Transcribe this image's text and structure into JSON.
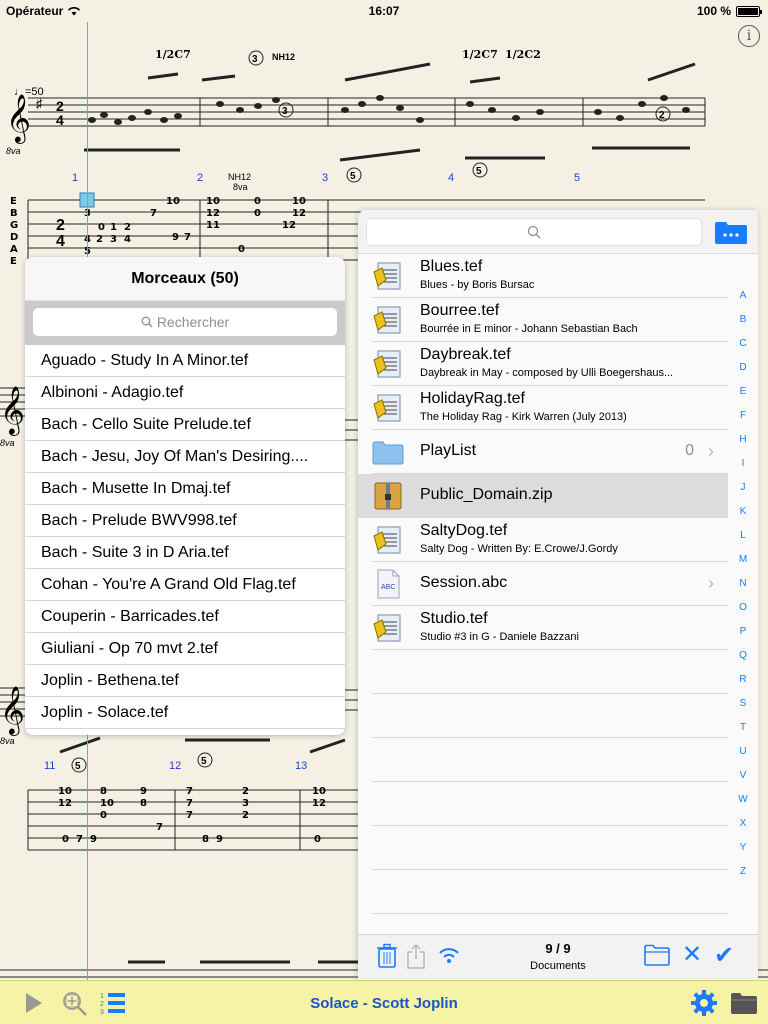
{
  "status": {
    "carrier": "Opérateur",
    "time": "16:07",
    "battery": "100 %"
  },
  "score": {
    "tempo": "♩=50",
    "measure_numbers": [
      "1",
      "2",
      "3",
      "4",
      "5",
      "11",
      "12",
      "13"
    ]
  },
  "library": {
    "title": "Morceaux (50)",
    "search_placeholder": "Rechercher",
    "items": [
      "Aguado - Study In A Minor.tef",
      "Albinoni - Adagio.tef",
      "Bach - Cello Suite Prelude.tef",
      "Bach - Jesu, Joy Of Man's Desiring....",
      "Bach - Musette In Dmaj.tef",
      "Bach - Prelude BWV998.tef",
      "Bach - Suite 3 in D Aria.tef",
      "Cohan - You're A Grand Old Flag.tef",
      "Couperin - Barricades.tef",
      "Giuliani - Op 70 mvt 2.tef",
      "Joplin - Bethena.tef",
      "Joplin - Solace.tef"
    ]
  },
  "files": {
    "rows": [
      {
        "icon": "tef-file-icon",
        "title": "Blues.tef",
        "subtitle": "Blues - by Boris Bursac"
      },
      {
        "icon": "tef-file-icon",
        "title": "Bourree.tef",
        "subtitle": "Bourrée in E minor - Johann Sebastian Bach"
      },
      {
        "icon": "tef-file-icon",
        "title": "Daybreak.tef",
        "subtitle": "Daybreak in May - composed by Ulli Boegershaus..."
      },
      {
        "icon": "tef-file-icon",
        "title": "HolidayRag.tef",
        "subtitle": "The Holiday Rag - Kirk Warren (July 2013)"
      },
      {
        "icon": "folder-icon",
        "title": "PlayList",
        "count": "0"
      },
      {
        "icon": "zip-file-icon",
        "title": "Public_Domain.zip"
      },
      {
        "icon": "tef-file-icon",
        "title": "SaltyDog.tef",
        "subtitle": "Salty Dog -   Written By: E.Crowe/J.Gordy"
      },
      {
        "icon": "abc-file-icon",
        "title": "Session.abc"
      },
      {
        "icon": "tef-file-icon",
        "title": "Studio.tef",
        "subtitle": "Studio #3 in G - Daniele Bazzani"
      }
    ],
    "index_letters": [
      "A",
      "B",
      "C",
      "D",
      "E",
      "F",
      "H",
      "I",
      "J",
      "K",
      "L",
      "M",
      "N",
      "O",
      "P",
      "Q",
      "R",
      "S",
      "T",
      "U",
      "V",
      "W",
      "X",
      "Y",
      "Z"
    ],
    "count": "9 / 9",
    "count_label": "Documents"
  },
  "toolbar": {
    "title": "Solace - Scott Joplin"
  },
  "colors": {
    "accent": "#1a7bff",
    "toolbar_bg": "#f7f3a6",
    "title_blue": "#1a55c8",
    "cursor": "#39c2d6"
  }
}
